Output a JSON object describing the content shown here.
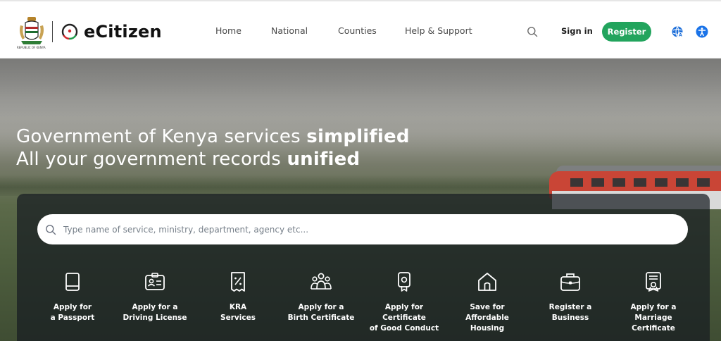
{
  "brand": {
    "name": "eCitizen",
    "coat_caption": "REPUBLIC OF KENYA"
  },
  "nav": {
    "items": [
      {
        "label": "Home"
      },
      {
        "label": "National"
      },
      {
        "label": "Counties"
      },
      {
        "label": "Help & Support"
      }
    ],
    "search_icon": "search-icon",
    "signin_label": "Sign in",
    "register_label": "Register",
    "language_icon": "globe-translate-icon",
    "accessibility_icon": "accessibility-icon"
  },
  "hero": {
    "line1_regular": "Government of Kenya services ",
    "line1_bold": "simplified",
    "line2_regular": "All your government records ",
    "line2_bold": "unified"
  },
  "search": {
    "placeholder": "Type name of service, ministry, department, agency etc..."
  },
  "services": [
    {
      "icon": "passport-icon",
      "lines": [
        "Apply for",
        "a Passport"
      ]
    },
    {
      "icon": "id-card-icon",
      "lines": [
        "Apply for a",
        "Driving License"
      ]
    },
    {
      "icon": "receipt-percent-icon",
      "lines": [
        "KRA",
        "Services"
      ]
    },
    {
      "icon": "people-group-icon",
      "lines": [
        "Apply for a",
        "Birth Certificate"
      ]
    },
    {
      "icon": "certificate-badge-icon",
      "lines": [
        "Apply for",
        "Certificate",
        "of Good Conduct"
      ]
    },
    {
      "icon": "house-icon",
      "lines": [
        "Save for",
        "Affordable",
        "Housing"
      ]
    },
    {
      "icon": "briefcase-icon",
      "lines": [
        "Register a",
        "Business"
      ]
    },
    {
      "icon": "marriage-certificate-icon",
      "lines": [
        "Apply for a",
        "Marriage",
        "Certificate"
      ]
    }
  ],
  "colors": {
    "accent_green": "#22a45d",
    "lang_icon_blue": "#1e6fd9",
    "a11y_icon_blue": "#1a73e8"
  }
}
